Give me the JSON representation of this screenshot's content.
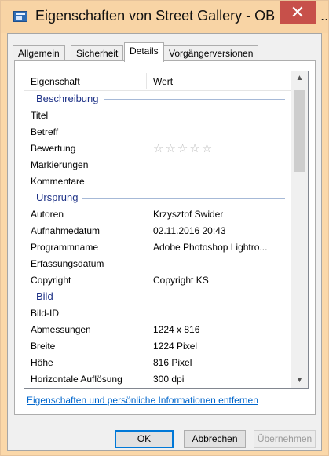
{
  "window": {
    "title": "Eigenschaften von Street Gallery - OB Reker ...",
    "close_glyph": "✕"
  },
  "tabs": [
    {
      "label": "Allgemein"
    },
    {
      "label": "Sicherheit"
    },
    {
      "label": "Details"
    },
    {
      "label": "Vorgängerversionen"
    }
  ],
  "grid": {
    "col_property": "Eigenschaft",
    "col_value": "Wert",
    "groups": {
      "beschreibung": "Beschreibung",
      "ursprung": "Ursprung",
      "bild": "Bild"
    },
    "rows": {
      "titel": {
        "label": "Titel",
        "value": ""
      },
      "betreff": {
        "label": "Betreff",
        "value": ""
      },
      "bewertung": {
        "label": "Bewertung",
        "value": "☆☆☆☆☆"
      },
      "markierungen": {
        "label": "Markierungen",
        "value": ""
      },
      "kommentare": {
        "label": "Kommentare",
        "value": ""
      },
      "autoren": {
        "label": "Autoren",
        "value": "Krzysztof Swider"
      },
      "aufnahmedatum": {
        "label": "Aufnahmedatum",
        "value": "02.11.2016 20:43"
      },
      "programmname": {
        "label": "Programmname",
        "value": "Adobe Photoshop Lightro..."
      },
      "erfassungsdatum": {
        "label": "Erfassungsdatum",
        "value": ""
      },
      "copyright": {
        "label": "Copyright",
        "value": "Copyright  KS"
      },
      "bild_id": {
        "label": "Bild-ID",
        "value": ""
      },
      "abmessungen": {
        "label": "Abmessungen",
        "value": "1224 x 816"
      },
      "breite": {
        "label": "Breite",
        "value": "1224 Pixel"
      },
      "hoehe": {
        "label": "Höhe",
        "value": "816 Pixel"
      },
      "horizontale": {
        "label": "Horizontale Auflösung",
        "value": "300 dpi"
      }
    }
  },
  "link_remove": "Eigenschaften und persönliche Informationen entfernen",
  "buttons": {
    "ok": "OK",
    "cancel": "Abbrechen",
    "apply": "Übernehmen"
  },
  "scroll": {
    "up_glyph": "▲",
    "down_glyph": "▼"
  },
  "colors": {
    "accent": "#0078d7",
    "title_bar": "#f8d4a5",
    "close_button": "#c7504a",
    "group_heading": "#1e3287",
    "link": "#0066cc"
  }
}
